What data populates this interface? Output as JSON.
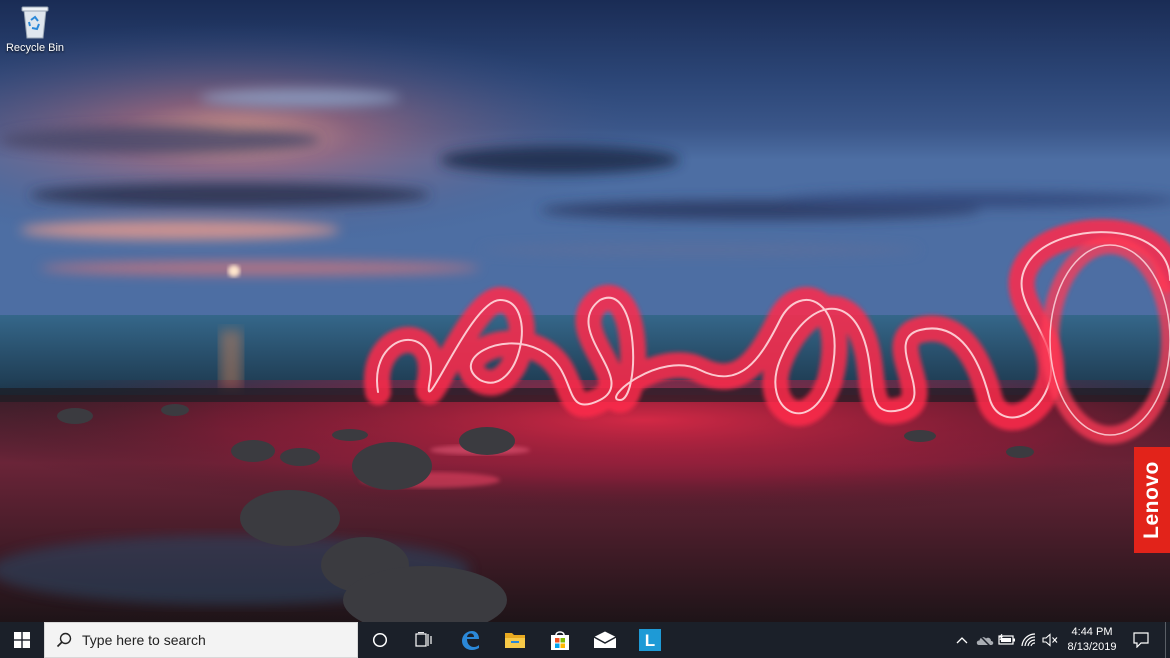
{
  "desktop": {
    "icons": [
      {
        "label": "Recycle Bin",
        "icon": "recycle-bin-icon"
      }
    ],
    "brand_badge": "Lenovo",
    "colors": {
      "brand": "#e2231a",
      "light_trail": "#ff2a4a"
    }
  },
  "taskbar": {
    "search_placeholder": "Type here to search",
    "pinned_apps": [
      "cortana-icon",
      "task-view-icon",
      "edge-icon",
      "file-explorer-icon",
      "store-icon",
      "mail-icon",
      "lenovo-vantage-icon"
    ],
    "lenovo_app_letter": "L",
    "tray_icons": [
      "chevron-up-icon",
      "onedrive-icon",
      "battery-icon",
      "wifi-icon",
      "volume-muted-icon"
    ],
    "clock": {
      "time": "4:44 PM",
      "date": "8/13/2019"
    },
    "colors": {
      "background": "#1b2029",
      "accent": "#2b88d8"
    }
  }
}
